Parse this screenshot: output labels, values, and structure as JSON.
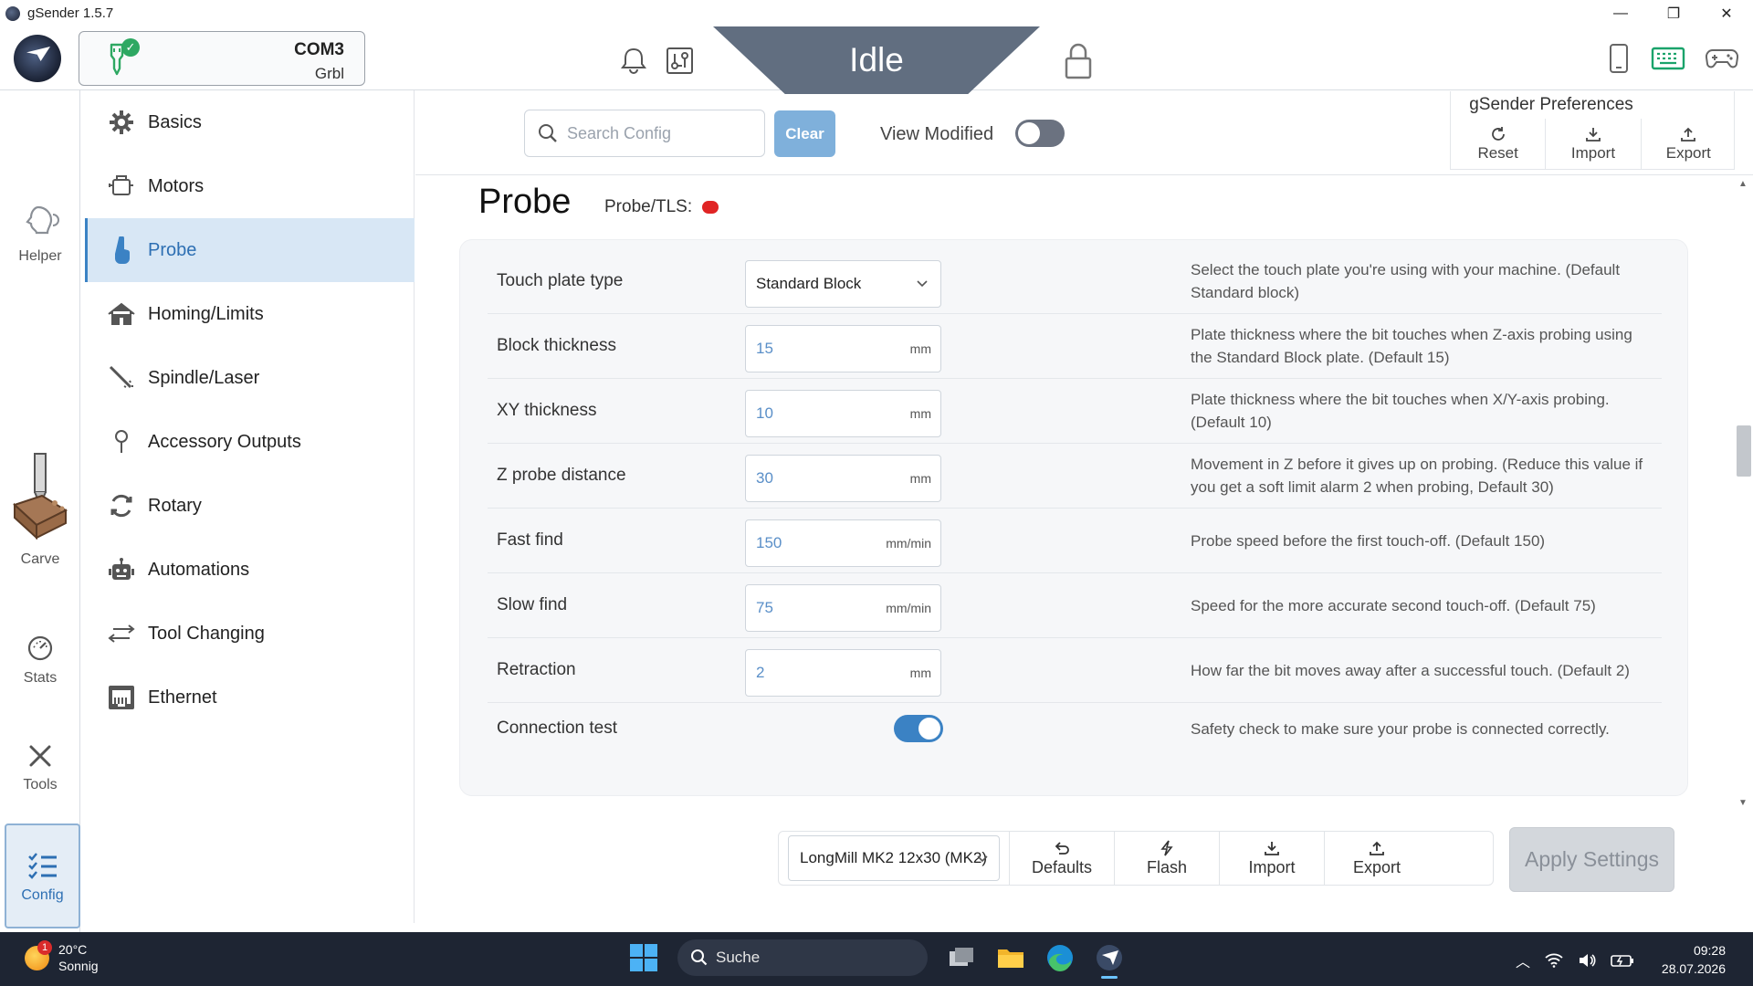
{
  "window": {
    "title": "gSender 1.5.7",
    "controls": [
      "—",
      "❐",
      "✕"
    ]
  },
  "header": {
    "connection": {
      "port": "COM3",
      "firmware": "Grbl",
      "status_color": "#2ea862"
    },
    "machine_state": "Idle",
    "icons": [
      "bell-icon",
      "board-icon",
      "lock-icon",
      "phone-icon",
      "keyboard-icon",
      "gamepad-icon"
    ]
  },
  "rail": {
    "items": [
      {
        "label": "Helper",
        "icon": "helper-icon"
      },
      {
        "label": "Carve",
        "icon": "carve-icon"
      },
      {
        "label": "Stats",
        "icon": "stats-icon"
      },
      {
        "label": "Tools",
        "icon": "tools-icon"
      },
      {
        "label": "Config",
        "icon": "config-icon",
        "active": true
      }
    ]
  },
  "menu": {
    "items": [
      {
        "label": "Basics",
        "icon": "gear-icon"
      },
      {
        "label": "Motors",
        "icon": "motor-icon"
      },
      {
        "label": "Probe",
        "icon": "probe-icon",
        "active": true
      },
      {
        "label": "Homing/Limits",
        "icon": "home-icon"
      },
      {
        "label": "Spindle/Laser",
        "icon": "spindle-icon"
      },
      {
        "label": "Accessory Outputs",
        "icon": "pin-icon"
      },
      {
        "label": "Rotary",
        "icon": "rotary-icon"
      },
      {
        "label": "Automations",
        "icon": "robot-icon"
      },
      {
        "label": "Tool Changing",
        "icon": "swap-icon"
      },
      {
        "label": "Ethernet",
        "icon": "ethernet-icon"
      }
    ]
  },
  "toolbar": {
    "search_placeholder": "Search Config",
    "clear_label": "Clear",
    "view_modified_label": "View Modified",
    "view_modified_on": false
  },
  "preferences": {
    "title": "gSender Preferences",
    "reset_label": "Reset",
    "import_label": "Import",
    "export_label": "Export"
  },
  "section": {
    "title": "Probe",
    "status_label": "Probe/TLS:",
    "status_color": "#e02424"
  },
  "settings": [
    {
      "label": "Touch plate type",
      "type": "select",
      "value": "Standard Block",
      "unit": "",
      "desc": "Select the touch plate you're using with your machine. (Default Standard block)"
    },
    {
      "label": "Block thickness",
      "type": "number",
      "value": "15",
      "unit": "mm",
      "desc": "Plate thickness where the bit touches when Z-axis probing using the Standard Block plate. (Default 15)"
    },
    {
      "label": "XY thickness",
      "type": "number",
      "value": "10",
      "unit": "mm",
      "desc": "Plate thickness where the bit touches when X/Y-axis probing. (Default 10)"
    },
    {
      "label": "Z probe distance",
      "type": "number",
      "value": "30",
      "unit": "mm",
      "desc": "Movement in Z before it gives up on probing. (Reduce this value if you get a soft limit alarm 2 when probing, Default 30)"
    },
    {
      "label": "Fast find",
      "type": "number",
      "value": "150",
      "unit": "mm/min",
      "desc": "Probe speed before the first touch-off. (Default 150)"
    },
    {
      "label": "Slow find",
      "type": "number",
      "value": "75",
      "unit": "mm/min",
      "desc": "Speed for the more accurate second touch-off. (Default 75)"
    },
    {
      "label": "Retraction",
      "type": "number",
      "value": "2",
      "unit": "mm",
      "desc": "How far the bit moves away after a successful touch. (Default 2)"
    },
    {
      "label": "Connection test",
      "type": "toggle",
      "value": true,
      "desc": "Safety check to make sure your probe is connected correctly."
    }
  ],
  "footer": {
    "machine_profile": "LongMill MK2 12x30 (MK2)",
    "defaults_label": "Defaults",
    "flash_label": "Flash",
    "import_label": "Import",
    "export_label": "Export",
    "apply_label": "Apply Settings"
  },
  "taskbar": {
    "weather_temp": "20°C",
    "weather_desc": "Sonnig",
    "weather_badge": "1",
    "search_label": "Suche",
    "time": "09:28",
    "date": "28.07.2026"
  },
  "colors": {
    "accent": "#3b82c4",
    "active_bg": "#d8e7f5",
    "state_banner": "#616e80",
    "taskbar": "#1e2533"
  }
}
